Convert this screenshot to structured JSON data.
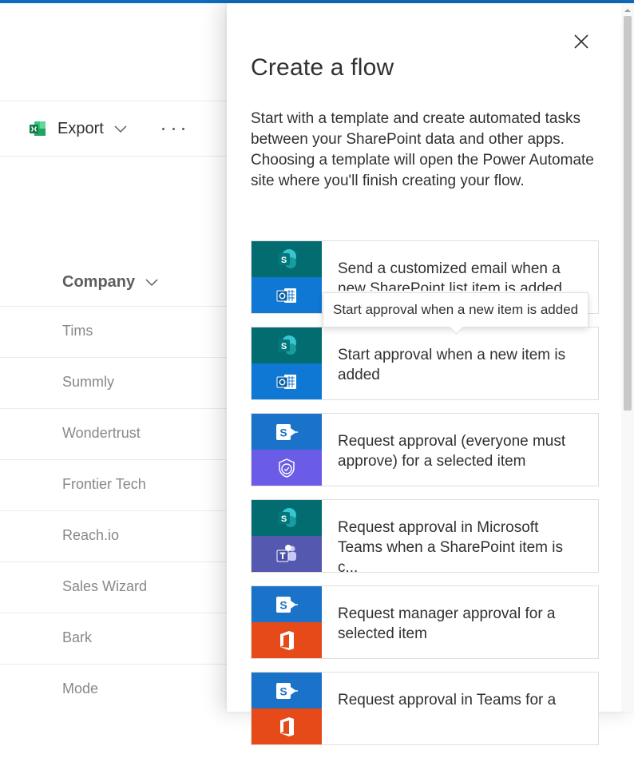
{
  "toolbar": {
    "export_label": "Export"
  },
  "list": {
    "column_header": "Company",
    "rows": [
      "Tims",
      "Summly",
      "Wondertrust",
      "Frontier Tech",
      "Reach.io",
      "Sales Wizard",
      "Bark",
      "Mode"
    ]
  },
  "panel": {
    "title": "Create a flow",
    "description": "Start with a template and create automated tasks between your SharePoint data and other apps. Choosing a template will open the Power Automate site where you'll finish creating your flow.",
    "templates": [
      {
        "title": "Send a customized email when a new SharePoint list item is added",
        "top_icon": "sharepoint-icon",
        "bottom_icon": "outlook-icon"
      },
      {
        "title": "Start approval when a new item is added",
        "top_icon": "sharepoint-icon",
        "bottom_icon": "outlook-icon"
      },
      {
        "title": "Request approval (everyone must approve) for a selected item",
        "top_icon": "sharepoint-flow-icon",
        "bottom_icon": "approvals-icon"
      },
      {
        "title": "Request approval in Microsoft Teams when a SharePoint item is c...",
        "top_icon": "sharepoint-icon",
        "bottom_icon": "teams-icon"
      },
      {
        "title": "Request manager approval for a selected item",
        "top_icon": "sharepoint-flow-icon",
        "bottom_icon": "office-icon"
      },
      {
        "title": "Request approval in Teams for a",
        "top_icon": "sharepoint-flow-icon",
        "bottom_icon": "office-icon"
      }
    ],
    "tooltip": "Start approval when a new item is added"
  },
  "colors": {
    "accent": "#0f6cbd",
    "sharepoint_green": "#036c70",
    "sharepoint_blue": "#1a73c8",
    "outlook_blue": "#0f78d4",
    "approvals_purple": "#6b5ce7",
    "teams_purple": "#5558af",
    "office_orange": "#e64a19"
  }
}
